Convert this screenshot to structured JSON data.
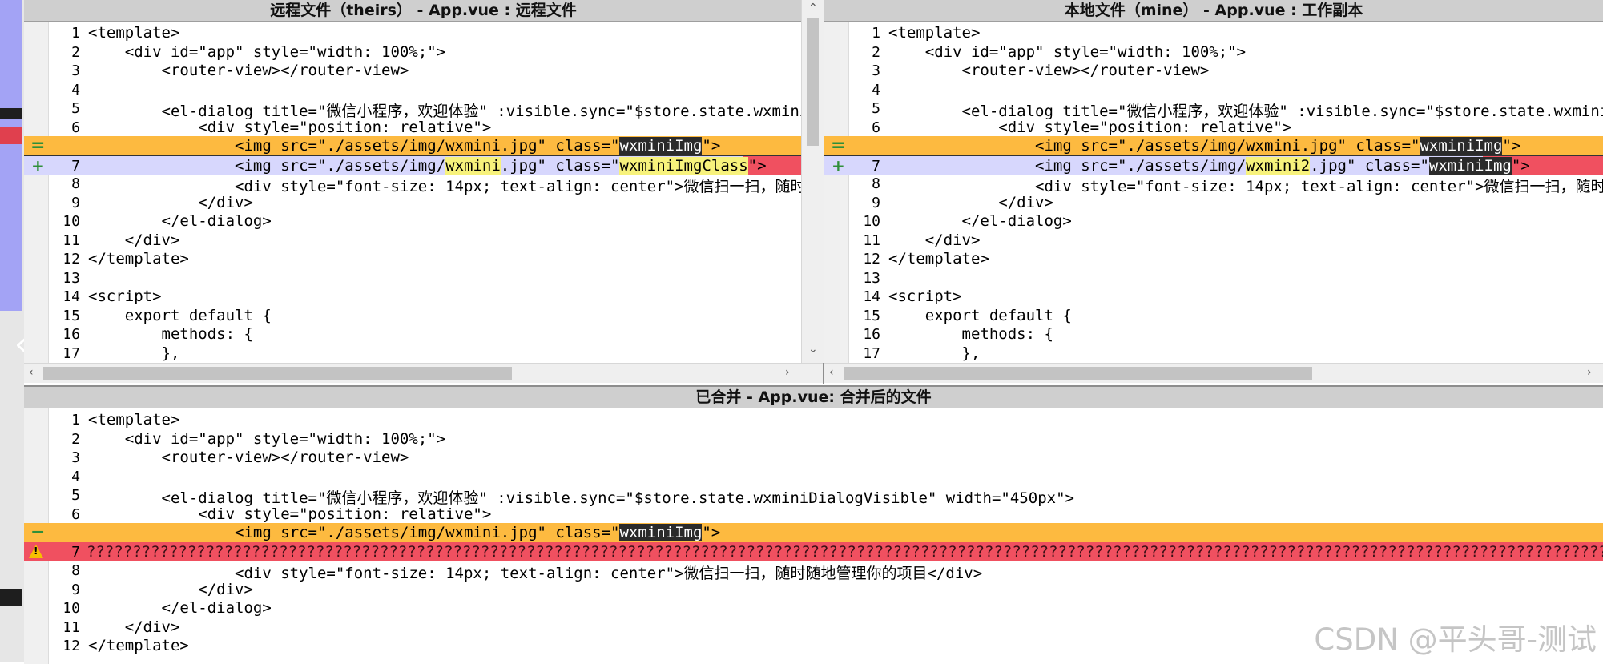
{
  "panes": {
    "theirs": {
      "title": "远程文件（theirs） - App.vue : 远程文件",
      "lines": [
        {
          "n": "1",
          "text": "<template>"
        },
        {
          "n": "2",
          "text": "    <div id=\"app\" style=\"width: 100%;\">"
        },
        {
          "n": "3",
          "text": "        <router-view></router-view>"
        },
        {
          "n": "4",
          "text": ""
        },
        {
          "n": "5",
          "text": "        <el-dialog title=\"微信小程序，欢迎体验\" :visible.sync=\"$store.state.wxminiD"
        },
        {
          "n": "6",
          "text": "            <div style=\"position: relative\">"
        },
        {
          "n": "",
          "text": ""
        },
        {
          "n": "7",
          "text": ""
        },
        {
          "n": "8",
          "text": "                <div style=\"font-size: 14px; text-align: center\">微信扫一扫，随时随"
        },
        {
          "n": "9",
          "text": "            </div>"
        },
        {
          "n": "10",
          "text": "        </el-dialog>"
        },
        {
          "n": "11",
          "text": "    </div>"
        },
        {
          "n": "12",
          "text": "</template>"
        },
        {
          "n": "13",
          "text": ""
        },
        {
          "n": "14",
          "text": "<script>"
        },
        {
          "n": "15",
          "text": "    export default {"
        },
        {
          "n": "16",
          "text": "        methods: {"
        },
        {
          "n": "17",
          "text": "        },"
        }
      ],
      "conflict_a": {
        "pre": "                <img src=\"./assets/img/wxmini.jpg\" class=\"",
        "hl": "wxminiImg",
        "post": "\">"
      },
      "conflict_b": {
        "pre": "                <img src=\"./assets/img/",
        "hl1": "wxmini",
        "mid": ".jpg\" class=\"",
        "hl2": "wxminiImgClass",
        "post": "\">"
      }
    },
    "mine": {
      "title": "本地文件（mine） - App.vue : 工作副本",
      "lines": [
        {
          "n": "1",
          "text": "<template>"
        },
        {
          "n": "2",
          "text": "    <div id=\"app\" style=\"width: 100%;\">"
        },
        {
          "n": "3",
          "text": "        <router-view></router-view>"
        },
        {
          "n": "4",
          "text": ""
        },
        {
          "n": "5",
          "text": "        <el-dialog title=\"微信小程序，欢迎体验\" :visible.sync=\"$store.state.wxminiD"
        },
        {
          "n": "6",
          "text": "            <div style=\"position: relative\">"
        },
        {
          "n": "",
          "text": ""
        },
        {
          "n": "7",
          "text": ""
        },
        {
          "n": "8",
          "text": "                <div style=\"font-size: 14px; text-align: center\">微信扫一扫，随时随"
        },
        {
          "n": "9",
          "text": "            </div>"
        },
        {
          "n": "10",
          "text": "        </el-dialog>"
        },
        {
          "n": "11",
          "text": "    </div>"
        },
        {
          "n": "12",
          "text": "</template>"
        },
        {
          "n": "13",
          "text": ""
        },
        {
          "n": "14",
          "text": "<script>"
        },
        {
          "n": "15",
          "text": "    export default {"
        },
        {
          "n": "16",
          "text": "        methods: {"
        },
        {
          "n": "17",
          "text": "        },"
        }
      ],
      "conflict_a": {
        "pre": "                <img src=\"./assets/img/wxmini.jpg\" class=\"",
        "hl": "wxminiImg",
        "post": "\">"
      },
      "conflict_b": {
        "pre": "                <img src=\"./assets/img/",
        "hl1": "wxmini2",
        "mid": ".jpg\" class=\"",
        "hl2": "wxminiImg",
        "post": "\">"
      }
    },
    "merged": {
      "title": "已合并 - App.vue: 合并后的文件",
      "lines": [
        {
          "n": "1",
          "text": "<template>"
        },
        {
          "n": "2",
          "text": "    <div id=\"app\" style=\"width: 100%;\">"
        },
        {
          "n": "3",
          "text": "        <router-view></router-view>"
        },
        {
          "n": "4",
          "text": ""
        },
        {
          "n": "5",
          "text": "        <el-dialog title=\"微信小程序，欢迎体验\" :visible.sync=\"$store.state.wxminiDialogVisible\" width=\"450px\">"
        },
        {
          "n": "6",
          "text": "            <div style=\"position: relative\">"
        },
        {
          "n": "",
          "text": ""
        },
        {
          "n": "7",
          "text": ""
        },
        {
          "n": "8",
          "text": "                <div style=\"font-size: 14px; text-align: center\">微信扫一扫，随时随地管理你的项目</div>"
        },
        {
          "n": "9",
          "text": "            </div>"
        },
        {
          "n": "10",
          "text": "        </el-dialog>"
        },
        {
          "n": "11",
          "text": "    </div>"
        },
        {
          "n": "12",
          "text": "</template>"
        }
      ],
      "conflict_a": {
        "pre": "                <img src=\"./assets/img/wxmini.jpg\" class=\"",
        "hl": "wxminiImg",
        "post": "\">"
      },
      "conflict_line": "???????????????????????????????????????????????????????????????????????????????????????????????????????????????????????????????????????????????????????????????????????????????????????????????"
    }
  },
  "markers": {
    "equal": "=",
    "added": "+",
    "removed": "−",
    "conflict": "!"
  },
  "scroll_arrows": {
    "up": "⌃",
    "down": "⌄",
    "left": "‹",
    "right": "›"
  },
  "watermark": "CSDN @平头哥-测试",
  "colors": {
    "conflict_orange": "#fdba40",
    "added_lilac": "#d7d7fd",
    "conflict_red": "#f05060",
    "left_strip": "#a3a3f5"
  }
}
